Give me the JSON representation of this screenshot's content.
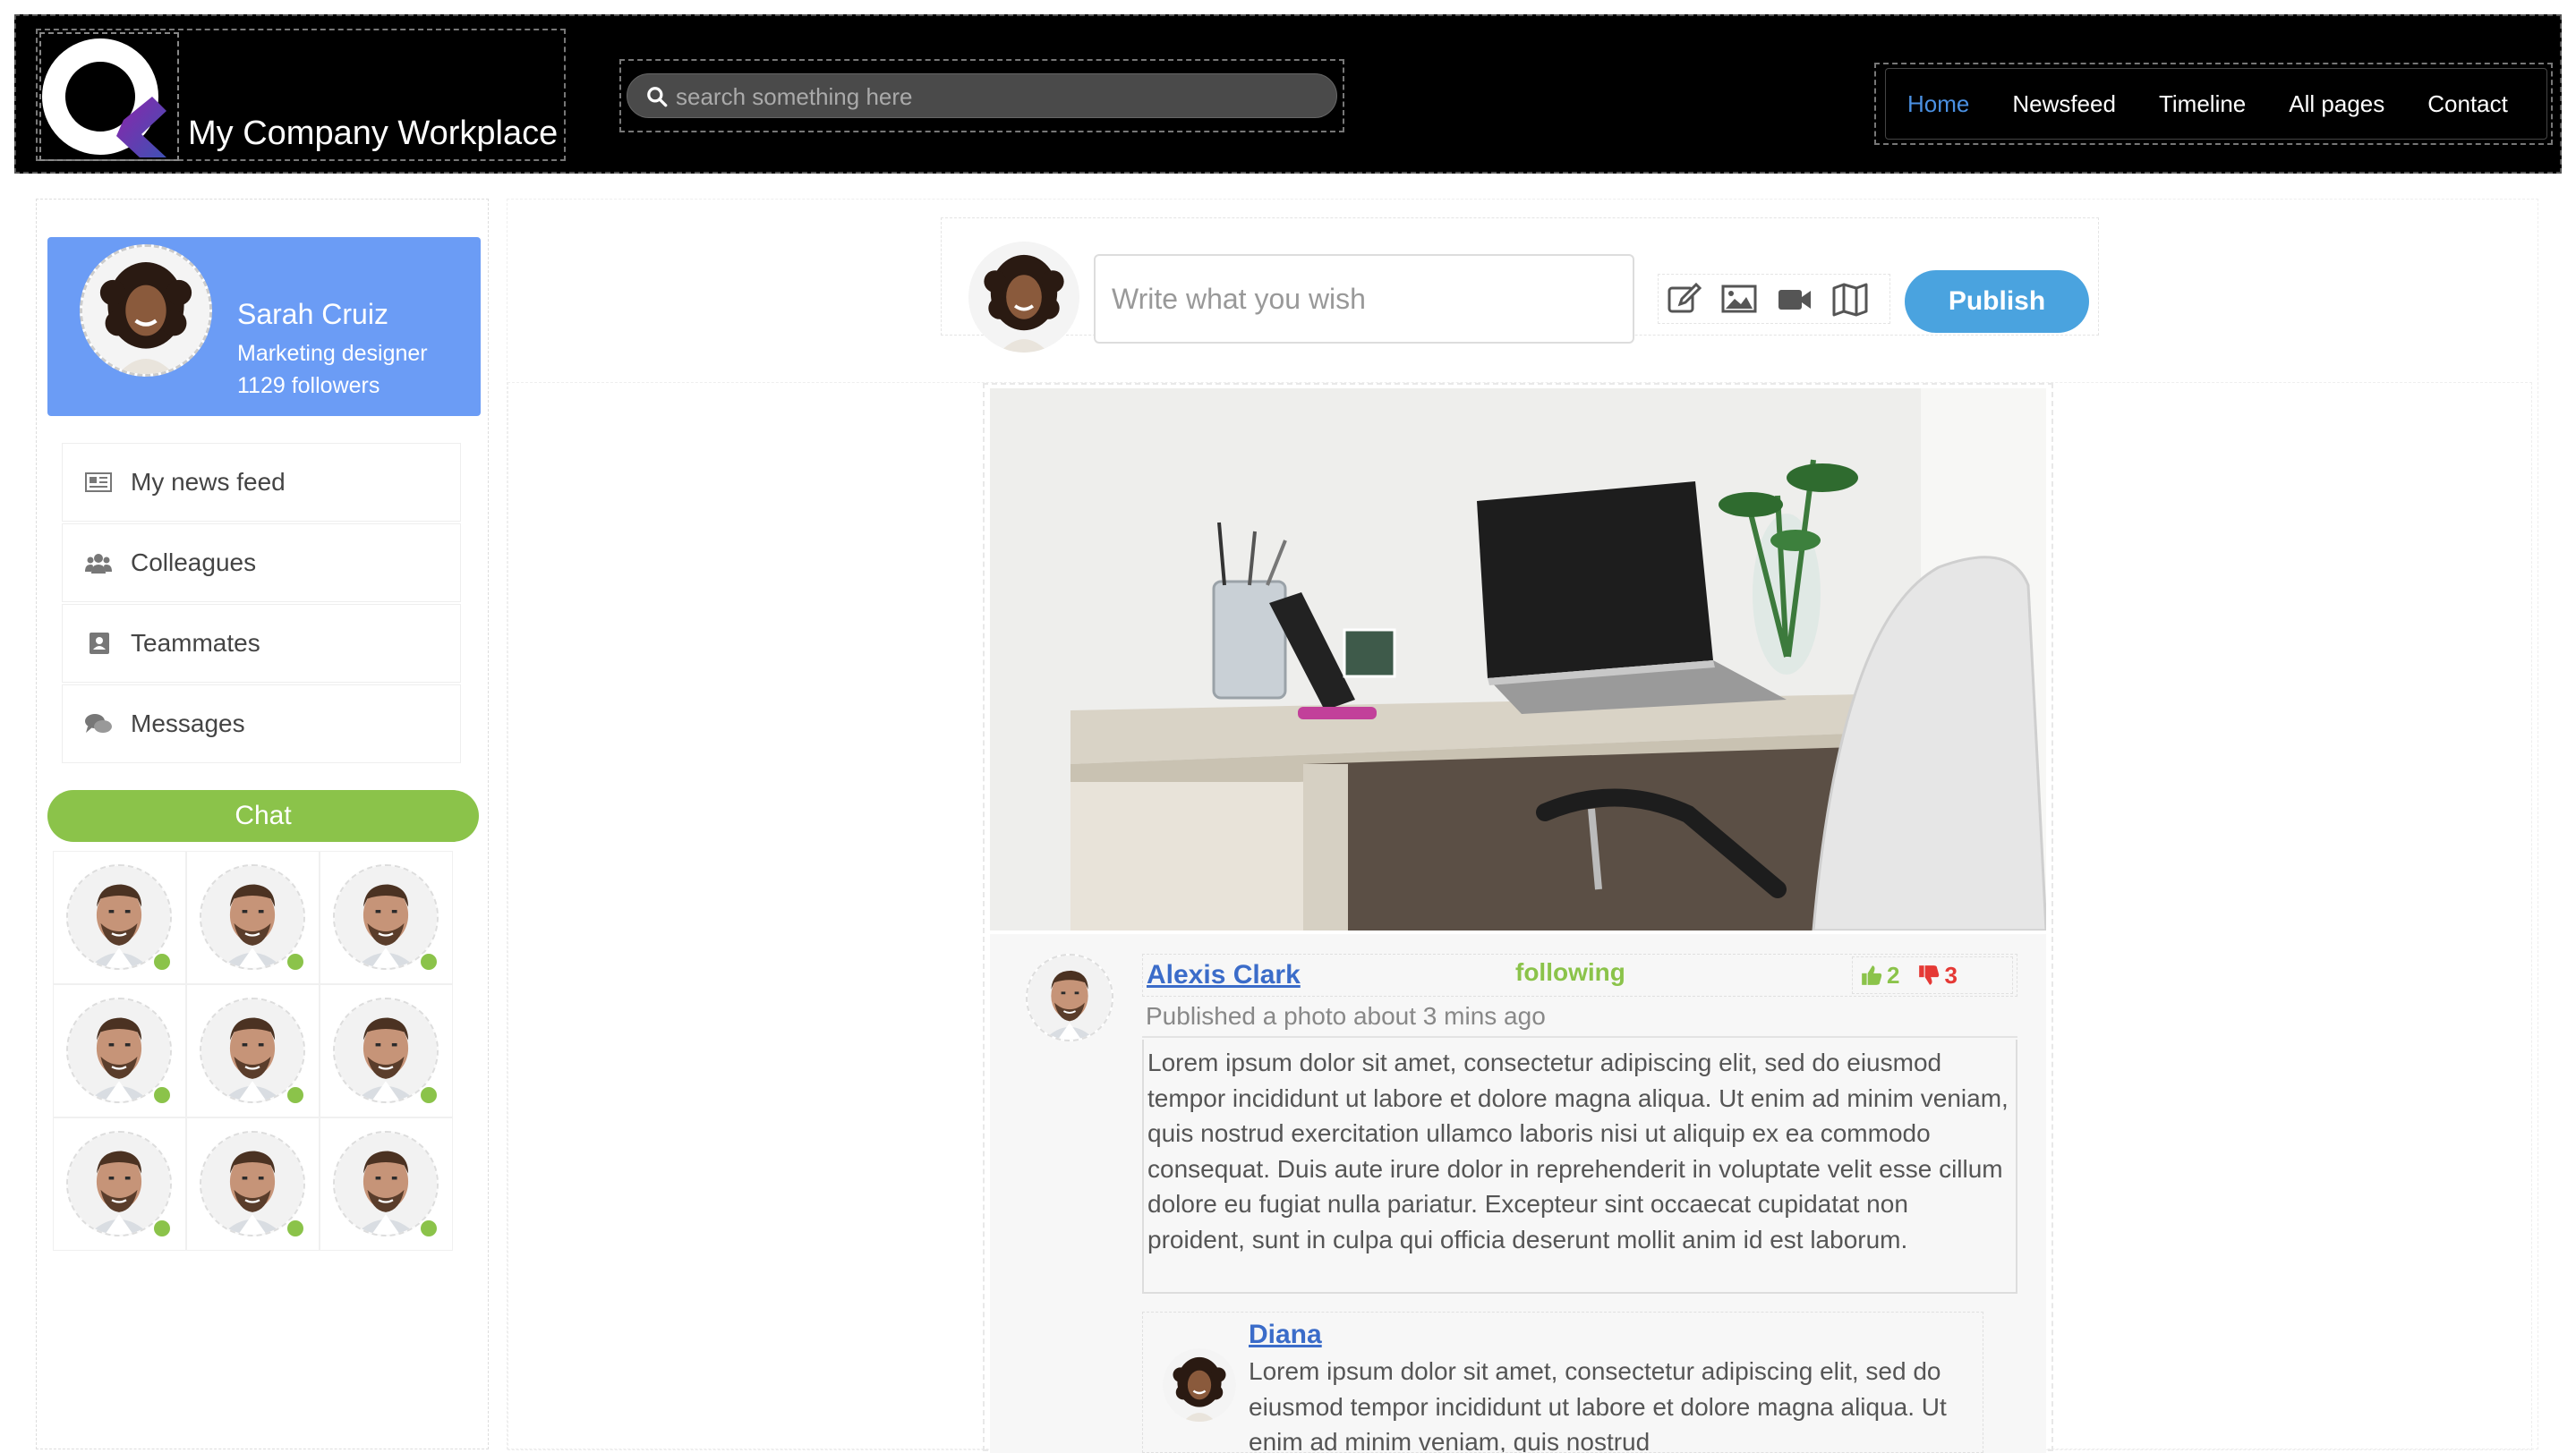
{
  "header": {
    "brand_name": "My Company Workplace",
    "search_placeholder": "search something here",
    "nav": [
      {
        "label": "Home",
        "active": true
      },
      {
        "label": "Newsfeed",
        "active": false
      },
      {
        "label": "Timeline",
        "active": false
      },
      {
        "label": "All pages",
        "active": false
      },
      {
        "label": "Contact",
        "active": false
      }
    ]
  },
  "profile": {
    "name": "Sarah Cruiz",
    "role": "Marketing designer",
    "followers": "1129 followers"
  },
  "menu": [
    {
      "label": "My news feed",
      "icon": "newspaper-icon"
    },
    {
      "label": "Colleagues",
      "icon": "users-icon"
    },
    {
      "label": "Teammates",
      "icon": "contact-book-icon"
    },
    {
      "label": "Messages",
      "icon": "chat-bubbles-icon"
    }
  ],
  "chat": {
    "button_label": "Chat",
    "online_count": 9
  },
  "composer": {
    "placeholder": "Write what you wish",
    "tools": [
      "edit-icon",
      "image-icon",
      "video-icon",
      "map-icon"
    ],
    "publish_label": "Publish"
  },
  "post": {
    "author": "Alexis Clark",
    "following_label": "following",
    "likes": "2",
    "dislikes": "3",
    "time": "Published a photo about 3 mins ago",
    "body": "Lorem ipsum dolor sit amet, consectetur adipiscing elit, sed do eiusmod tempor incididunt ut labore et dolore magna aliqua. Ut enim ad minim veniam, quis nostrud exercitation ullamco laboris nisi ut aliquip ex ea commodo consequat. Duis aute irure dolor in reprehenderit in voluptate velit esse cillum dolore eu fugiat nulla pariatur. Excepteur sint occaecat cupidatat non proident, sunt in culpa qui officia deserunt mollit anim id est laborum.",
    "comment": {
      "author": "Diana",
      "text": "Lorem ipsum dolor sit amet, consectetur adipiscing elit, sed do eiusmod tempor incididunt ut labore et dolore magna aliqua. Ut enim ad minim veniam, quis nostrud"
    }
  },
  "colors": {
    "header_bg": "#000000",
    "accent_blue": "#4a90e2",
    "profile_bg": "#6b9cf5",
    "green": "#8bc34a",
    "red": "#e53935",
    "publish_bg": "#4aa3df",
    "link": "#3b6cc9"
  }
}
